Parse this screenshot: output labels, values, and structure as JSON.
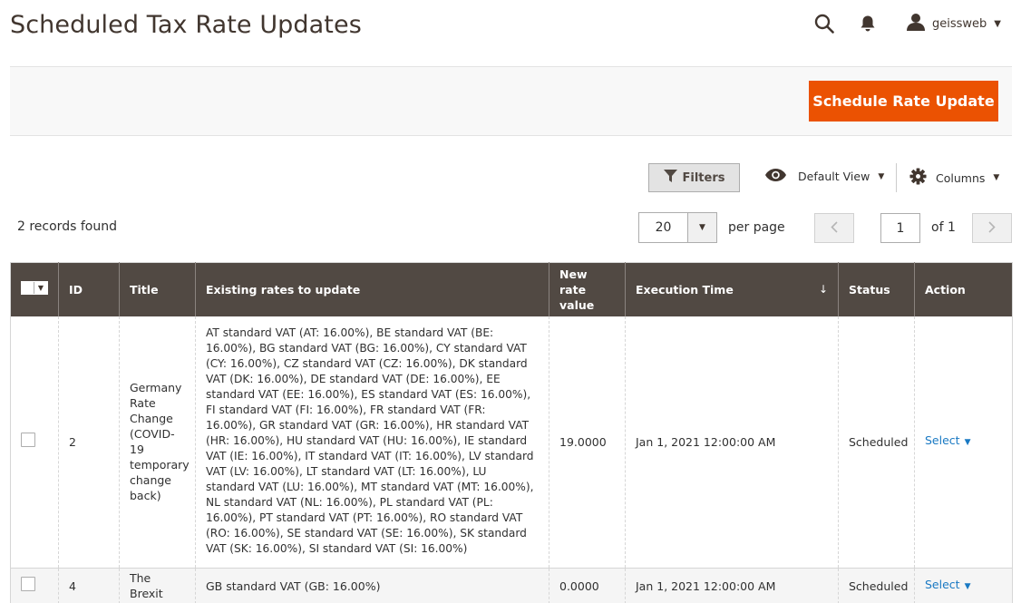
{
  "page": {
    "title": "Scheduled Tax Rate Updates"
  },
  "header": {
    "user_name": "geissweb"
  },
  "action_bar": {
    "primary_button": "Schedule Rate Update"
  },
  "toolbar": {
    "filters_label": "Filters",
    "view_label": "Default View",
    "columns_label": "Columns",
    "records_found": "2 records found",
    "per_page_value": "20",
    "per_page_label": "per page",
    "current_page": "1",
    "page_total": "of 1"
  },
  "grid": {
    "columns": [
      "ID",
      "Title",
      "Existing rates to update",
      "New rate value",
      "Execution Time",
      "Status",
      "Action"
    ],
    "sort_indicator": "↓",
    "rows": [
      {
        "id": "2",
        "title": "Germany Rate Change (COVID-19 temporary change back)",
        "existing_rates": "AT standard VAT (AT: 16.00%), BE standard VAT (BE: 16.00%), BG standard VAT (BG: 16.00%), CY standard VAT (CY: 16.00%), CZ standard VAT (CZ: 16.00%), DK standard VAT (DK: 16.00%), DE standard VAT (DE: 16.00%), EE standard VAT (EE: 16.00%), ES standard VAT (ES: 16.00%), FI standard VAT (FI: 16.00%), FR standard VAT (FR: 16.00%), GR standard VAT (GR: 16.00%), HR standard VAT (HR: 16.00%), HU standard VAT (HU: 16.00%), IE standard VAT (IE: 16.00%), IT standard VAT (IT: 16.00%), LV standard VAT (LV: 16.00%), LT standard VAT (LT: 16.00%), LU standard VAT (LU: 16.00%), MT standard VAT (MT: 16.00%), NL standard VAT (NL: 16.00%), PL standard VAT (PL: 16.00%), PT standard VAT (PT: 16.00%), RO standard VAT (RO: 16.00%), SE standard VAT (SE: 16.00%), SK standard VAT (SK: 16.00%), SI standard VAT (SI: 16.00%)",
        "new_rate": "19.0000",
        "execution_time": "Jan 1, 2021 12:00:00 AM",
        "status": "Scheduled",
        "action": "Select"
      },
      {
        "id": "4",
        "title": "The Brexit",
        "existing_rates": "GB standard VAT (GB: 16.00%)",
        "new_rate": "0.0000",
        "execution_time": "Jan 1, 2021 12:00:00 AM",
        "status": "Scheduled",
        "action": "Select"
      }
    ]
  }
}
